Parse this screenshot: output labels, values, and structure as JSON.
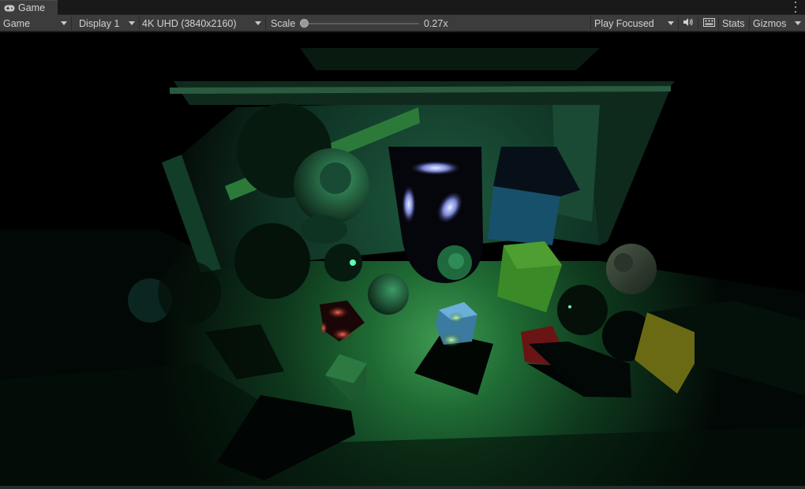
{
  "tab": {
    "label": "Game",
    "icon": "gamepad-icon"
  },
  "toolbar": {
    "mode": "Game",
    "display": "Display 1",
    "resolution": "4K UHD (3840x2160)",
    "scale_label": "Scale",
    "scale_value": "0.27x",
    "scale_fraction": 0.0,
    "play_mode": "Play Focused",
    "stats_label": "Stats",
    "gizmos_label": "Gizmos",
    "icons": [
      "audio-icon",
      "keyboard-icon",
      "more-options-icon"
    ]
  },
  "colors": {
    "toolbar_bg": "#3c3c3c",
    "panel_bg": "#191919",
    "scene_light": "#3a8c4a"
  }
}
